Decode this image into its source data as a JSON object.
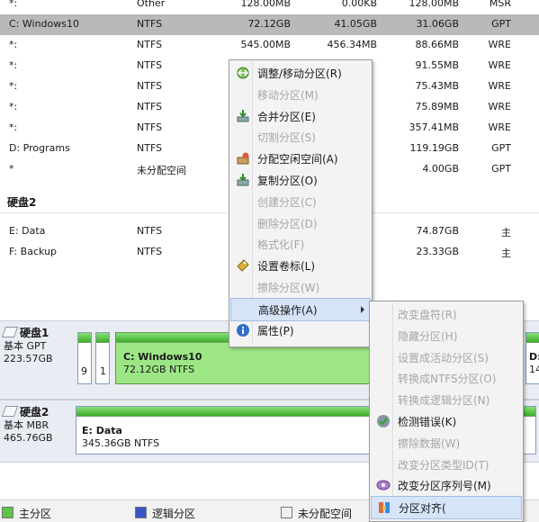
{
  "partitions_disk1": [
    {
      "name": "*:",
      "fs": "Other",
      "capacity": "128.00MB",
      "used": "0.00KB",
      "free": "128.00MB",
      "type": "MSR"
    },
    {
      "name": "C: Windows10",
      "fs": "NTFS",
      "capacity": "72.12GB",
      "used": "41.05GB",
      "free": "31.06GB",
      "type": "GPT"
    },
    {
      "name": "*:",
      "fs": "NTFS",
      "capacity": "545.00MB",
      "used": "456.34MB",
      "free": "88.66MB",
      "type": "WRE"
    },
    {
      "name": "*:",
      "fs": "NTFS",
      "capacity": "",
      "used": "",
      "free": "91.55MB",
      "type": "WRE"
    },
    {
      "name": "*:",
      "fs": "NTFS",
      "capacity": "",
      "used": "",
      "free": "75.43MB",
      "type": "WRE"
    },
    {
      "name": "*:",
      "fs": "NTFS",
      "capacity": "",
      "used": "",
      "free": "75.89MB",
      "type": "WRE"
    },
    {
      "name": "*:",
      "fs": "NTFS",
      "capacity": "",
      "used": "",
      "free": "357.41MB",
      "type": "WRE"
    },
    {
      "name": "D: Programs",
      "fs": "NTFS",
      "capacity": "",
      "used": "",
      "free": "119.19GB",
      "type": "GPT"
    },
    {
      "name": "*",
      "fs": "未分配空间",
      "capacity": "",
      "used": "",
      "free": "4.00GB",
      "type": "GPT"
    }
  ],
  "disk2_heading": "硬盘2",
  "partitions_disk2": [
    {
      "name": "E: Data",
      "fs": "NTFS",
      "capacity": "",
      "used": "",
      "free": "74.87GB",
      "type": "主"
    },
    {
      "name": "F: Backup",
      "fs": "NTFS",
      "capacity": "",
      "used": "",
      "free": "23.33GB",
      "type": "主"
    }
  ],
  "diskmap": {
    "disk1": {
      "title": "硬盘1",
      "style": "基本 GPT",
      "size": "223.57GB",
      "small1": "9",
      "small2": "1",
      "main_label": "C: Windows10",
      "main_info": "72.12GB NTFS",
      "edge_label": "D:",
      "edge_info": "14"
    },
    "disk2": {
      "title": "硬盘2",
      "style": "基本 MBR",
      "size": "465.76GB",
      "main_label": "E: Data",
      "main_info": "345.36GB NTFS"
    }
  },
  "context_menu": [
    {
      "label": "调整/移动分区(R)",
      "enabled": true,
      "icon": "resize-icon"
    },
    {
      "label": "移动分区(M)",
      "enabled": false,
      "icon": ""
    },
    {
      "label": "合并分区(E)",
      "enabled": true,
      "icon": "merge-icon"
    },
    {
      "label": "切割分区(S)",
      "enabled": false,
      "icon": ""
    },
    {
      "label": "分配空闲空间(A)",
      "enabled": true,
      "icon": "allocate-icon"
    },
    {
      "label": "复制分区(O)",
      "enabled": true,
      "icon": "copy-icon"
    },
    {
      "label": "创建分区(C)",
      "enabled": false,
      "icon": ""
    },
    {
      "label": "删除分区(D)",
      "enabled": false,
      "icon": ""
    },
    {
      "label": "格式化(F)",
      "enabled": false,
      "icon": ""
    },
    {
      "label": "设置卷标(L)",
      "enabled": true,
      "icon": "label-icon"
    },
    {
      "label": "擦除分区(W)",
      "enabled": false,
      "icon": ""
    },
    {
      "label": "高级操作(A)",
      "enabled": true,
      "icon": "",
      "highlighted": true,
      "submenu": true
    },
    {
      "label": "属性(P)",
      "enabled": true,
      "icon": "info-icon"
    }
  ],
  "submenu": [
    {
      "label": "改变盘符(R)",
      "enabled": false,
      "icon": ""
    },
    {
      "label": "隐藏分区(H)",
      "enabled": false,
      "icon": ""
    },
    {
      "label": "设置成活动分区(S)",
      "enabled": false,
      "icon": ""
    },
    {
      "label": "转换成NTFS分区(O)",
      "enabled": false,
      "icon": ""
    },
    {
      "label": "转换成逻辑分区(N)",
      "enabled": false,
      "icon": ""
    },
    {
      "label": "检测错误(K)",
      "enabled": true,
      "icon": "check-icon"
    },
    {
      "label": "擦除数据(W)",
      "enabled": false,
      "icon": ""
    },
    {
      "label": "改变分区类型ID(T)",
      "enabled": false,
      "icon": ""
    },
    {
      "label": "改变分区序列号(M)",
      "enabled": true,
      "icon": "serial-icon"
    },
    {
      "label": "分区对齐(",
      "enabled": true,
      "icon": "align-icon",
      "highlighted": true
    }
  ],
  "legend": [
    {
      "label": "主分区",
      "color": "#5fc24a"
    },
    {
      "label": "逻辑分区",
      "color": "#3a56c6"
    },
    {
      "label": "未分配空间",
      "color": "#f0f0f0"
    }
  ],
  "colors": {
    "selected_row": "#b9b9b9",
    "menu_highlight": "#d6e4f7",
    "partition_green": "#3cae2a"
  }
}
